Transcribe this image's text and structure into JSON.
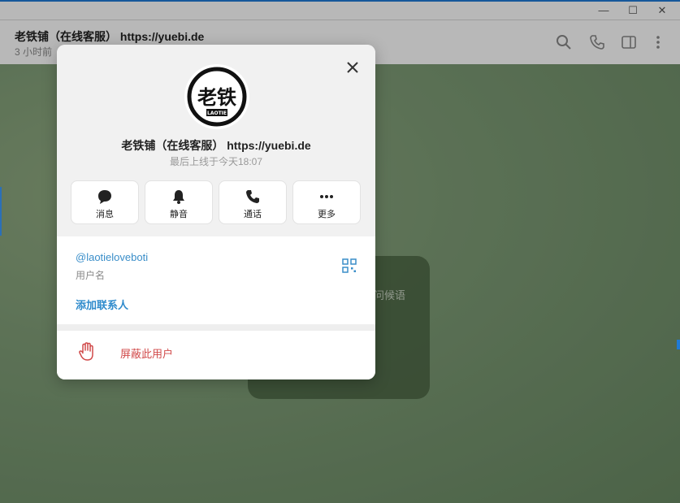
{
  "window": {
    "minimize": "—",
    "maximize": "☐",
    "close": "✕"
  },
  "chat": {
    "title": "老铁铺（在线客服）",
    "title_url": "https://yuebi.de",
    "status": "3 小时前",
    "bubble_text": "问候语"
  },
  "profile": {
    "avatar_text": "老铁",
    "avatar_subtext": "LAOTIE",
    "name": "老铁铺（在线客服）  https://yuebi.de",
    "last_seen": "最后上线于今天18:07",
    "actions": [
      {
        "label": "消息",
        "icon": "message-icon"
      },
      {
        "label": "静音",
        "icon": "bell-icon"
      },
      {
        "label": "通话",
        "icon": "phone-icon"
      },
      {
        "label": "更多",
        "icon": "more-icon"
      }
    ],
    "username": "@laotieloveboti",
    "username_label": "用户名",
    "add_contact": "添加联系人",
    "block": "屏蔽此用户"
  },
  "colors": {
    "accent": "#2f8bcc",
    "danger": "#d14a4a"
  }
}
